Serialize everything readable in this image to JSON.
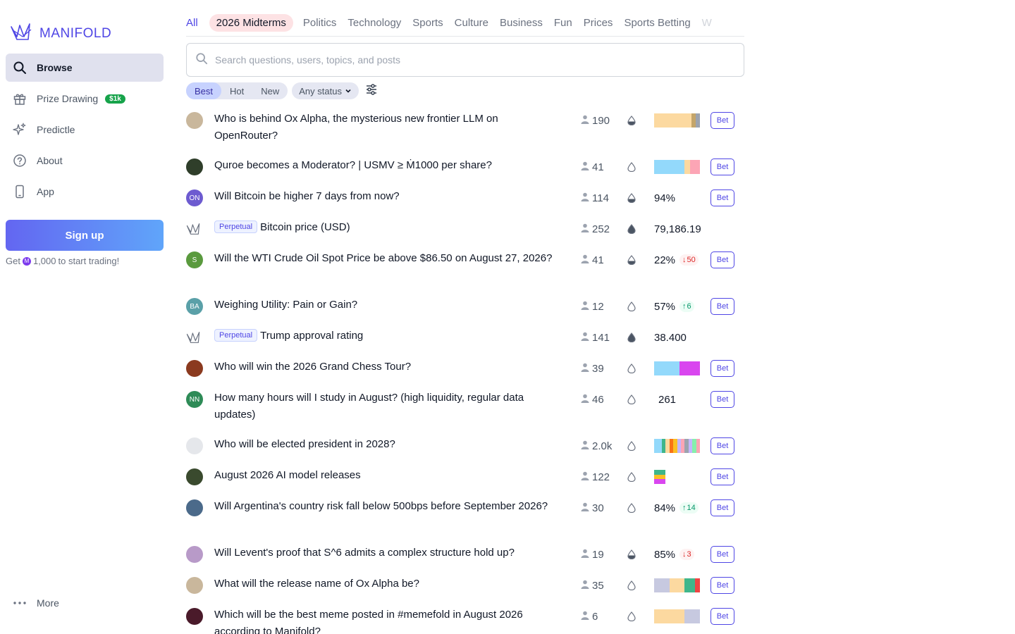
{
  "sidebar": {
    "logo_text": "MANIFOLD",
    "nav": [
      {
        "label": "Browse",
        "icon": "search-icon",
        "active": true
      },
      {
        "label": "Prize Drawing",
        "icon": "gift-icon",
        "badge": "$1k"
      },
      {
        "label": "Predictle",
        "icon": "sparkles-icon"
      },
      {
        "label": "About",
        "icon": "question-circle-icon"
      },
      {
        "label": "App",
        "icon": "phone-icon"
      }
    ],
    "signup_label": "Sign up",
    "signup_note_prefix": "Get",
    "signup_note_amount": "1,000",
    "signup_note_suffix": "to start trading!",
    "more_label": "More"
  },
  "topics": [
    "All",
    "2026 Midterms",
    "Politics",
    "Technology",
    "Sports",
    "Culture",
    "Business",
    "Fun",
    "Prices",
    "Sports Betting",
    "W"
  ],
  "search": {
    "placeholder": "Search questions, users, topics, and posts"
  },
  "filters": {
    "sort_options": [
      "Best",
      "Hot",
      "New"
    ],
    "sort_active": "Best",
    "status_label": "Any status"
  },
  "colors": {
    "accent": "#4f46e5",
    "signup_start": "#6366f1",
    "signup_end": "#60a5fa",
    "prize_badge": "#16a34a"
  },
  "markets": [
    {
      "title": "Who is behind Ox Alpha, the mysterious new frontier LLM on OpenRouter?",
      "traders": "190",
      "bar": [
        "#fcd9a0",
        "#fcd9a0",
        "#fcd9a0",
        "#fcd9a0",
        "#fcd9a0",
        "#fcd9a0",
        "#fcd9a0",
        "#fcd9a0",
        "#fcd9a0",
        "#c4a56a",
        "#9ca3af"
      ],
      "bet": "Bet",
      "avatar": "#c9b79c",
      "avatar_text": ""
    },
    {
      "title": "Quroe becomes a Moderator? | USMV ≥ Ṁ1000 per share?",
      "traders": "41",
      "bar": [
        "#93d9fb",
        "#93d9fb",
        "#93d9fb",
        "#93d9fb",
        "#93d9fb",
        "#93d9fb",
        "#fcd9a0",
        "#fca5b5",
        "#fca5b5"
      ],
      "bet": "Bet",
      "avatar": "#2f3e2a",
      "avatar_text": ""
    },
    {
      "title": "Will Bitcoin be higher 7 days from now?",
      "traders": "114",
      "prob": "94%",
      "bet": "Bet",
      "avatar": "#6d5bd0",
      "avatar_text": "ON"
    },
    {
      "title": "Bitcoin price (USD)",
      "perpetual": "Perpetual",
      "traders": "252",
      "prob": "79,186.19",
      "avatar": "manifold",
      "avatar_text": ""
    },
    {
      "title": "Will the WTI Crude Oil Spot Price be above $86.50 on August 27, 2026?",
      "traders": "41",
      "prob": "22%",
      "delta": "50",
      "delta_dir": "down",
      "bet": "Bet",
      "avatar": "#5a9a3e",
      "avatar_text": "S"
    },
    {
      "title": "Weighing Utility: Pain or Gain?",
      "traders": "12",
      "prob": "57%",
      "delta": "6",
      "delta_dir": "up",
      "bet": "Bet",
      "avatar": "#5aa0a8",
      "avatar_text": "BA"
    },
    {
      "title": "Trump approval rating",
      "perpetual": "Perpetual",
      "traders": "141",
      "prob": "38.400",
      "avatar": "manifold",
      "avatar_text": ""
    },
    {
      "title": "Who will win the 2026 Grand Chess Tour?",
      "traders": "39",
      "bar": [
        "#93d9fb",
        "#93d9fb",
        "#93d9fb",
        "#93d9fb",
        "#93d9fb",
        "#d946ef",
        "#d946ef",
        "#d946ef",
        "#d946ef"
      ],
      "bet": "Bet",
      "avatar": "#8b3a1f",
      "avatar_text": ""
    },
    {
      "title": "How many hours will I study in August? (high liquidity, regular data updates)",
      "traders": "46",
      "prob": "261",
      "bet": "Bet",
      "avatar": "#2e8b57",
      "avatar_text": "NN"
    },
    {
      "title": "Who will be elected president in 2028?",
      "traders": "2.0k",
      "bar": [
        "#93d9fb",
        "#93d9fb",
        "#3fb68b",
        "#fcd9a0",
        "#f97316",
        "#fbbf24",
        "#c4b5fd",
        "#fca5b5",
        "#9ca3af",
        "#c4b5fd",
        "#86efac",
        "#fca5b5"
      ],
      "bet": "Bet",
      "avatar": "#e5e7eb",
      "avatar_text": ""
    },
    {
      "title": "August 2026 AI model releases",
      "traders": "122",
      "stack": [
        "#3fb68b",
        "#fbbf24",
        "#d946ef"
      ],
      "bet": "Bet",
      "avatar": "#3a4a2e",
      "avatar_text": ""
    },
    {
      "title": "Will Argentina's country risk fall below 500bps before September 2026?",
      "traders": "30",
      "prob": "84%",
      "delta": "14",
      "delta_dir": "up",
      "bet": "Bet",
      "avatar": "#4b6a8a",
      "avatar_text": ""
    },
    {
      "title": "Will Levent's proof that S^6 admits a complex structure hold up?",
      "traders": "19",
      "prob": "85%",
      "delta": "3",
      "delta_dir": "down",
      "bet": "Bet",
      "avatar": "#b89ac8",
      "avatar_text": ""
    },
    {
      "title": "What will the release name of Ox Alpha be?",
      "traders": "35",
      "bar": [
        "#c7c9e0",
        "#c7c9e0",
        "#c7c9e0",
        "#fcd9a0",
        "#fcd9a0",
        "#fcd9a0",
        "#3fb68b",
        "#3fb68b",
        "#ef4444"
      ],
      "bet": "Bet",
      "avatar": "#c9b79c",
      "avatar_text": ""
    },
    {
      "title": "Which will be the best meme posted in #memefold in August 2026 according to Manifold?",
      "traders": "6",
      "bar": [
        "#fcd9a0",
        "#fcd9a0",
        "#fcd9a0",
        "#fcd9a0",
        "#fcd9a0",
        "#fcd9a0",
        "#c7c9e0",
        "#c7c9e0",
        "#c7c9e0"
      ],
      "bet": "Bet",
      "avatar": "#4a1a2a",
      "avatar_text": ""
    }
  ]
}
